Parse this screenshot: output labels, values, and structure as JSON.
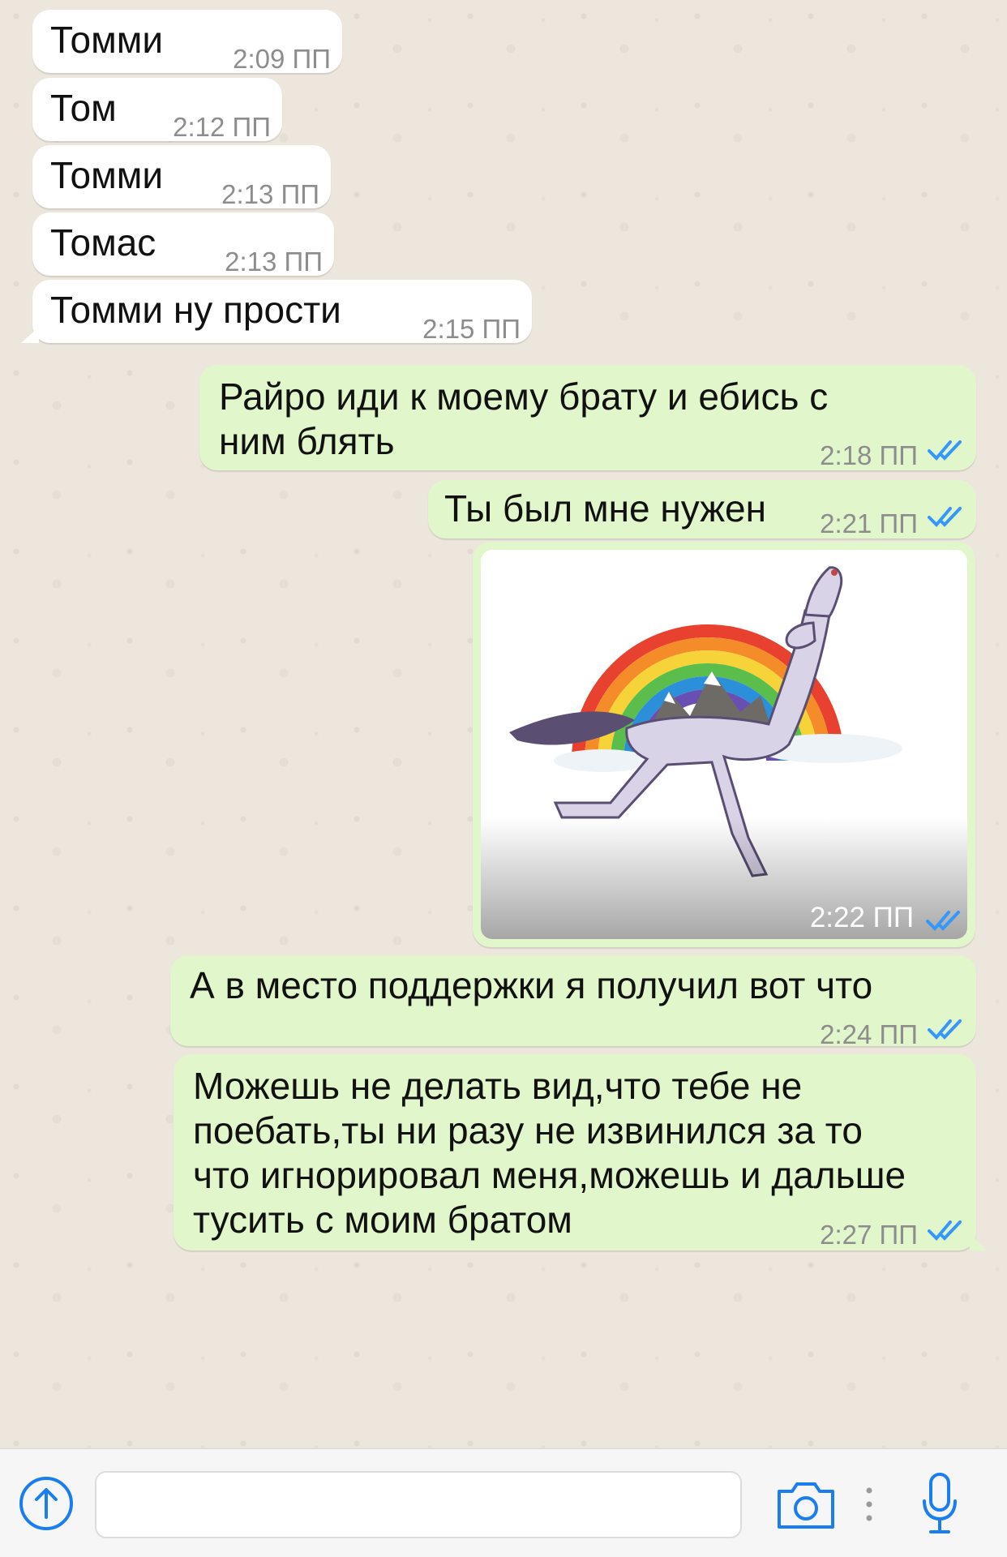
{
  "messages": [
    {
      "direction": "incoming",
      "text": "Томми",
      "time": "2:09 ПП"
    },
    {
      "direction": "incoming",
      "text": "Том",
      "time": "2:12 ПП"
    },
    {
      "direction": "incoming",
      "text": "Томми",
      "time": "2:13 ПП"
    },
    {
      "direction": "incoming",
      "text": "Томас",
      "time": "2:13 ПП"
    },
    {
      "direction": "incoming",
      "text": "Томми ну прости",
      "time": "2:15 ПП"
    },
    {
      "direction": "outgoing",
      "text": "Райро иди к моему брату и ебись с\nним блять",
      "time": "2:18 ПП",
      "status": "read"
    },
    {
      "direction": "outgoing",
      "text": "Ты был мне нужен",
      "time": "2:21 ПП",
      "status": "read"
    },
    {
      "direction": "outgoing",
      "type": "sticker",
      "sticker": "rainbow-horse-sticker",
      "time": "2:22 ПП",
      "status": "read"
    },
    {
      "direction": "outgoing",
      "text": "А в место поддержки я получил вот что",
      "time": "2:24 ПП",
      "status": "read"
    },
    {
      "direction": "outgoing",
      "text": "Можешь не делать вид,что тебе не\nпоебать,ты ни разу не извинился за то\nчто игнорировал меня,можешь и дальше\nтусить с моим братом",
      "time": "2:27 ПП",
      "status": "read"
    }
  ],
  "input_bar": {
    "attach_icon": "arrow-up-circle-icon",
    "message_placeholder": "",
    "camera_icon": "camera-icon",
    "more_icon": "vertical-dots-icon",
    "mic_icon": "microphone-icon"
  },
  "colors": {
    "incoming_bubble": "#ffffff",
    "outgoing_bubble": "#e1f6cb",
    "read_ticks": "#3497f9",
    "accent": "#1a7ef0",
    "chat_background": "#ece6dc"
  }
}
